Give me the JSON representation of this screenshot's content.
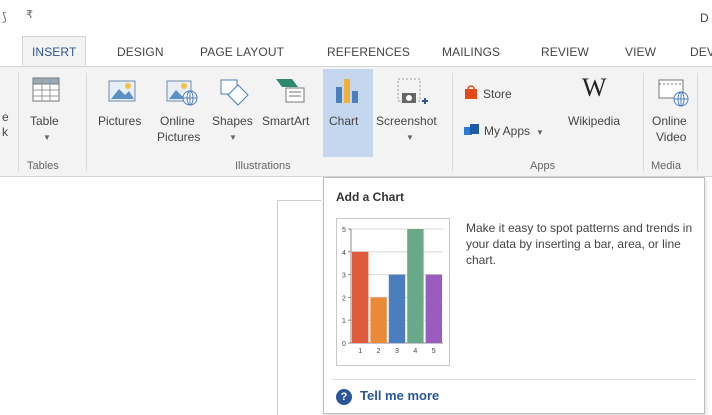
{
  "window": {
    "qa_left": "⟆",
    "qa_arrow": "₹",
    "title_partial": "D"
  },
  "tabs": [
    {
      "label": "INSERT",
      "active": true
    },
    {
      "label": "DESIGN"
    },
    {
      "label": "PAGE LAYOUT"
    },
    {
      "label": "REFERENCES"
    },
    {
      "label": "MAILINGS"
    },
    {
      "label": "REVIEW"
    },
    {
      "label": "VIEW"
    },
    {
      "label": "DEV"
    }
  ],
  "ribbon": {
    "cut_left": {
      "line1": "e",
      "line2": "k"
    },
    "tables": {
      "table_label": "Table",
      "group_label": "Tables"
    },
    "illustrations": {
      "pictures": "Pictures",
      "online_pictures_1": "Online",
      "online_pictures_2": "Pictures",
      "shapes": "Shapes",
      "smartart": "SmartArt",
      "chart": "Chart",
      "screenshot": "Screenshot",
      "group_label": "Illustrations"
    },
    "apps": {
      "store": "Store",
      "my_apps": "My Apps",
      "wikipedia": "Wikipedia",
      "group_label": "Apps"
    },
    "media": {
      "online_video_1": "Online",
      "online_video_2": "Video",
      "group_label": "Media"
    }
  },
  "tooltip": {
    "title": "Add a Chart",
    "description": "Make it easy to spot patterns and trends in your data by inserting a bar, area, or line chart.",
    "tell_me_more": "Tell me more",
    "help_glyph": "?"
  },
  "chart_data": {
    "type": "bar",
    "categories": [
      "1",
      "2",
      "3",
      "4",
      "5"
    ],
    "values": [
      4,
      2,
      3,
      5,
      3
    ],
    "colors": [
      "#de5b3c",
      "#e88a3a",
      "#4a7ebf",
      "#6aa88a",
      "#9a5cbf"
    ],
    "ylim": [
      0,
      5
    ],
    "yticks": [
      "0",
      "1",
      "2",
      "3",
      "4",
      "5"
    ],
    "grid": true
  },
  "colors": {
    "accent": "#2b579a",
    "selected": "#c5d7ee"
  }
}
